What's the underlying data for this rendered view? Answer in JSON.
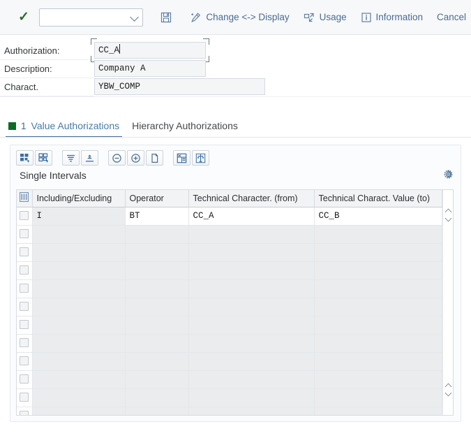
{
  "toolbar": {
    "confirm_icon": "checkmark-icon",
    "select_value": "",
    "select_placeholder": "",
    "save_label": "",
    "save_icon": "save-floppy-icon",
    "change_display_label": "Change <-> Display",
    "change_display_icon": "pen-wand-icon",
    "usage_label": "Usage",
    "usage_icon": "usage-arrow-icon",
    "information_label": "Information",
    "information_icon": "information-icon",
    "cancel_label": "Cancel"
  },
  "form": {
    "rows": [
      {
        "label": "Authorization:",
        "value": "CC_A",
        "focused": true
      },
      {
        "label": "Description:",
        "value": "Company A",
        "focused": false
      },
      {
        "label": "Charact.",
        "value": "YBW_COMP",
        "focused": false
      }
    ]
  },
  "tabs": [
    {
      "label": "Value Authorizations",
      "count": "1",
      "marker": "green-square-icon",
      "active": true
    },
    {
      "label": "Hierarchy Authorizations",
      "count": "",
      "marker": "",
      "active": false
    }
  ],
  "panel": {
    "title": "Single Intervals",
    "settings_icon": "gear-icon",
    "tool_groups": [
      [
        {
          "icon": "select-all-cells-icon"
        },
        {
          "icon": "deselect-all-cells-icon"
        }
      ],
      [
        {
          "icon": "filter-icon"
        },
        {
          "icon": "sort-icon"
        }
      ],
      [
        {
          "icon": "delete-row-icon"
        },
        {
          "icon": "insert-row-icon"
        },
        {
          "icon": "copy-row-icon"
        }
      ],
      [
        {
          "icon": "table-layout-icon"
        },
        {
          "icon": "maintain-icon"
        }
      ]
    ]
  },
  "grid": {
    "select_all_icon": "column-select-icon",
    "columns": [
      "Including/Excluding",
      "Operator",
      "Technical Character. (from)",
      "Technical Charact. Value (to)"
    ],
    "rows": [
      {
        "including_excluding": "I",
        "operator": "BT",
        "from": "CC_A",
        "to": "CC_B"
      },
      {
        "including_excluding": "",
        "operator": "",
        "from": "",
        "to": ""
      },
      {
        "including_excluding": "",
        "operator": "",
        "from": "",
        "to": ""
      },
      {
        "including_excluding": "",
        "operator": "",
        "from": "",
        "to": ""
      },
      {
        "including_excluding": "",
        "operator": "",
        "from": "",
        "to": ""
      },
      {
        "including_excluding": "",
        "operator": "",
        "from": "",
        "to": ""
      },
      {
        "including_excluding": "",
        "operator": "",
        "from": "",
        "to": ""
      },
      {
        "including_excluding": "",
        "operator": "",
        "from": "",
        "to": ""
      },
      {
        "including_excluding": "",
        "operator": "",
        "from": "",
        "to": ""
      },
      {
        "including_excluding": "",
        "operator": "",
        "from": "",
        "to": ""
      },
      {
        "including_excluding": "",
        "operator": "",
        "from": "",
        "to": ""
      },
      {
        "including_excluding": "",
        "operator": "",
        "from": "",
        "to": ""
      }
    ]
  },
  "colors": {
    "toolbar_bg": "#f7f8fa",
    "link_blue": "#4a6c92",
    "tab_active_blue": "#4a7ba7",
    "green_marker": "#0c6b25",
    "header_grey": "#f2f3f5",
    "empty_cell": "#ebecee"
  }
}
